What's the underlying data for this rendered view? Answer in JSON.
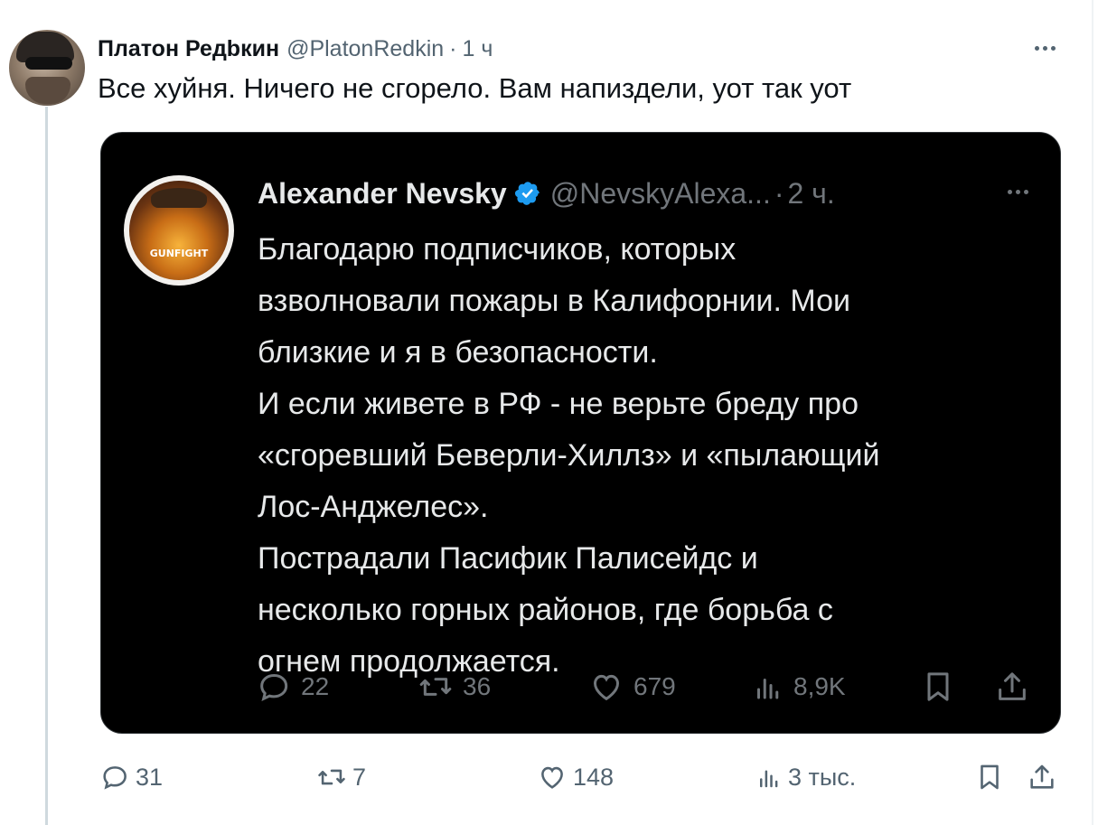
{
  "reply": {
    "author_name": "Платон Редbкин",
    "handle": "@PlatonRedkin",
    "separator": "·",
    "time": "1 ч",
    "text": "Все хуйня. Ничего не сгорело. Вам напиздели, уот так уот",
    "stats": {
      "replies": "31",
      "reposts": "7",
      "likes": "148",
      "views": "3 тыс."
    }
  },
  "quoted_tweet": {
    "author_name": "Alexander Nevsky",
    "verified": true,
    "handle": "@NevskyAlexa...",
    "separator": "·",
    "time": "2 ч.",
    "avatar_logo_text": "GUNFIGHT",
    "text_lines": [
      "Благодарю подписчиков, которых",
      "взволновали пожары в Калифорнии. Мои",
      "близкие и я в безопасности.",
      "И если живете в РФ - не верьте бреду про",
      "«сгоревший Беверли-Хиллз» и «пылающий",
      "Лос-Анджелес».",
      "Пострадали Пасифик Палисейдс и",
      "несколько горных районов, где борьба с",
      "огнем продолжается."
    ],
    "stats": {
      "replies": "22",
      "reposts": "36",
      "likes": "679",
      "views": "8,9K"
    }
  },
  "colors": {
    "accent": "#1d9bf0",
    "secondary_text": "#536471",
    "quote_background": "#000000",
    "quote_text": "#e7e9ea",
    "quote_secondary": "#71767b"
  }
}
